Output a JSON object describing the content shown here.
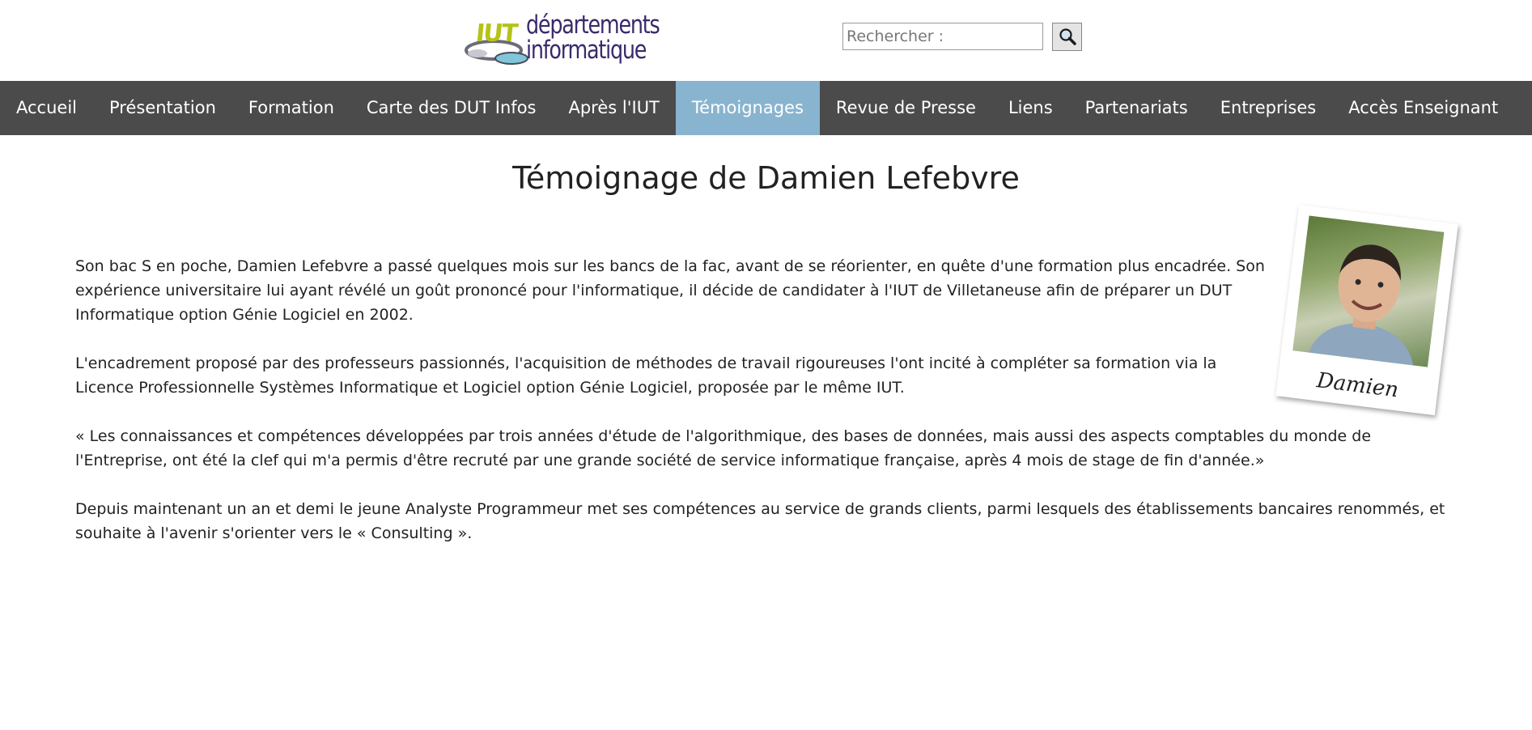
{
  "header": {
    "logo": {
      "brand": "IUT",
      "line1": "départements",
      "line2": "informatique"
    },
    "search": {
      "placeholder": "Rechercher :"
    }
  },
  "nav": {
    "items": [
      {
        "label": "Accueil"
      },
      {
        "label": "Présentation"
      },
      {
        "label": "Formation"
      },
      {
        "label": "Carte des DUT Infos"
      },
      {
        "label": "Après l'IUT"
      },
      {
        "label": "Témoignages"
      },
      {
        "label": "Revue de Presse"
      },
      {
        "label": "Liens"
      },
      {
        "label": "Partenariats"
      },
      {
        "label": "Entreprises"
      },
      {
        "label": "Accès Enseignant"
      }
    ],
    "active_item": "Témoignages",
    "colors": {
      "bar": "#4b4b4b",
      "active": "#89b4cf",
      "text": "#ffffff"
    }
  },
  "main": {
    "title": "Témoignage de Damien Lefebvre",
    "photo_caption": "Damien",
    "paragraphs": [
      "Son bac S en poche, Damien Lefebvre a passé quelques mois sur les bancs de la fac, avant de se réorienter, en quête d'une formation plus encadrée. Son expérience universitaire lui ayant révélé un goût prononcé pour l'informatique, il décide de candidater à l'IUT de Villetaneuse afin de préparer un DUT Informatique option Génie Logiciel en 2002.",
      "L'encadrement proposé par des professeurs passionnés, l'acquisition de méthodes de travail rigoureuses l'ont incité à compléter sa formation via la Licence Professionnelle Systèmes Informatique et Logiciel option Génie Logiciel, proposée par le même IUT.",
      "« Les connaissances et compétences développées par trois années d'étude de l'algorithmique, des bases de données, mais aussi des aspects comptables du monde de l'Entreprise, ont été la clef qui m'a permis d'être recruté par une grande société de service informatique française, après 4 mois de stage de fin d'année.»",
      "Depuis maintenant un an et demi le jeune Analyste Programmeur met ses compétences au service de grands clients, parmi lesquels des établissements bancaires renommés, et souhaite à l'avenir s'orienter vers le « Consulting »."
    ]
  }
}
